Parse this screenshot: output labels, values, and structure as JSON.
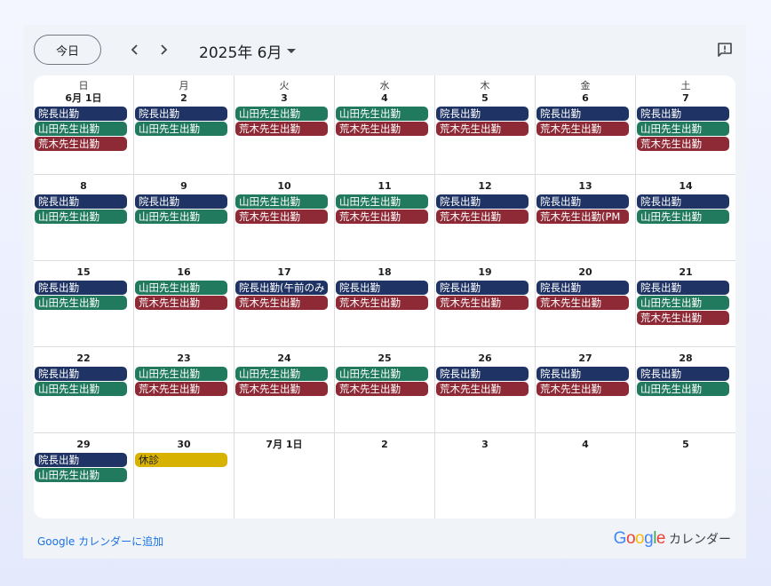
{
  "toolbar": {
    "today_label": "今日",
    "month_title": "2025年 6月"
  },
  "weekdays": [
    "日",
    "月",
    "火",
    "水",
    "木",
    "金",
    "土"
  ],
  "colors": {
    "navy": "#1f3464",
    "green": "#217a5d",
    "red": "#8e2a36",
    "yellow": "#d7b200"
  },
  "days": [
    {
      "label": "6月 1日",
      "events": [
        {
          "t": "院長出勤",
          "c": "navy"
        },
        {
          "t": "山田先生出勤",
          "c": "green"
        },
        {
          "t": "荒木先生出勤",
          "c": "red"
        }
      ]
    },
    {
      "label": "2",
      "events": [
        {
          "t": "院長出勤",
          "c": "navy"
        },
        {
          "t": "山田先生出勤",
          "c": "green"
        }
      ]
    },
    {
      "label": "3",
      "events": [
        {
          "t": "山田先生出勤",
          "c": "green"
        },
        {
          "t": "荒木先生出勤",
          "c": "red"
        }
      ]
    },
    {
      "label": "4",
      "events": [
        {
          "t": "山田先生出勤",
          "c": "green"
        },
        {
          "t": "荒木先生出勤",
          "c": "red"
        }
      ]
    },
    {
      "label": "5",
      "events": [
        {
          "t": "院長出勤",
          "c": "navy"
        },
        {
          "t": "荒木先生出勤",
          "c": "red"
        }
      ]
    },
    {
      "label": "6",
      "events": [
        {
          "t": "院長出勤",
          "c": "navy"
        },
        {
          "t": "荒木先生出勤",
          "c": "red"
        }
      ]
    },
    {
      "label": "7",
      "events": [
        {
          "t": "院長出勤",
          "c": "navy"
        },
        {
          "t": "山田先生出勤",
          "c": "green"
        },
        {
          "t": "荒木先生出勤",
          "c": "red"
        }
      ]
    },
    {
      "label": "8",
      "events": [
        {
          "t": "院長出勤",
          "c": "navy"
        },
        {
          "t": "山田先生出勤",
          "c": "green"
        }
      ]
    },
    {
      "label": "9",
      "events": [
        {
          "t": "院長出勤",
          "c": "navy"
        },
        {
          "t": "山田先生出勤",
          "c": "green"
        }
      ]
    },
    {
      "label": "10",
      "events": [
        {
          "t": "山田先生出勤",
          "c": "green"
        },
        {
          "t": "荒木先生出勤",
          "c": "red"
        }
      ]
    },
    {
      "label": "11",
      "events": [
        {
          "t": "山田先生出勤",
          "c": "green"
        },
        {
          "t": "荒木先生出勤",
          "c": "red"
        }
      ]
    },
    {
      "label": "12",
      "events": [
        {
          "t": "院長出勤",
          "c": "navy"
        },
        {
          "t": "荒木先生出勤",
          "c": "red"
        }
      ]
    },
    {
      "label": "13",
      "events": [
        {
          "t": "院長出勤",
          "c": "navy"
        },
        {
          "t": "荒木先生出勤(PM",
          "c": "red"
        }
      ]
    },
    {
      "label": "14",
      "events": [
        {
          "t": "院長出勤",
          "c": "navy"
        },
        {
          "t": "山田先生出勤",
          "c": "green"
        }
      ]
    },
    {
      "label": "15",
      "events": [
        {
          "t": "院長出勤",
          "c": "navy"
        },
        {
          "t": "山田先生出勤",
          "c": "green"
        }
      ]
    },
    {
      "label": "16",
      "events": [
        {
          "t": "山田先生出勤",
          "c": "green"
        },
        {
          "t": "荒木先生出勤",
          "c": "red"
        }
      ]
    },
    {
      "label": "17",
      "events": [
        {
          "t": "院長出勤(午前のみ",
          "c": "navy"
        },
        {
          "t": "荒木先生出勤",
          "c": "red"
        }
      ]
    },
    {
      "label": "18",
      "events": [
        {
          "t": "院長出勤",
          "c": "navy"
        },
        {
          "t": "荒木先生出勤",
          "c": "red"
        }
      ]
    },
    {
      "label": "19",
      "events": [
        {
          "t": "院長出勤",
          "c": "navy"
        },
        {
          "t": "荒木先生出勤",
          "c": "red"
        }
      ]
    },
    {
      "label": "20",
      "events": [
        {
          "t": "院長出勤",
          "c": "navy"
        },
        {
          "t": "荒木先生出勤",
          "c": "red"
        }
      ]
    },
    {
      "label": "21",
      "events": [
        {
          "t": "院長出勤",
          "c": "navy"
        },
        {
          "t": "山田先生出勤",
          "c": "green"
        },
        {
          "t": "荒木先生出勤",
          "c": "red"
        }
      ]
    },
    {
      "label": "22",
      "events": [
        {
          "t": "院長出勤",
          "c": "navy"
        },
        {
          "t": "山田先生出勤",
          "c": "green"
        }
      ]
    },
    {
      "label": "23",
      "events": [
        {
          "t": "山田先生出勤",
          "c": "green"
        },
        {
          "t": "荒木先生出勤",
          "c": "red"
        }
      ]
    },
    {
      "label": "24",
      "events": [
        {
          "t": "山田先生出勤",
          "c": "green"
        },
        {
          "t": "荒木先生出勤",
          "c": "red"
        }
      ]
    },
    {
      "label": "25",
      "events": [
        {
          "t": "山田先生出勤",
          "c": "green"
        },
        {
          "t": "荒木先生出勤",
          "c": "red"
        }
      ]
    },
    {
      "label": "26",
      "events": [
        {
          "t": "院長出勤",
          "c": "navy"
        },
        {
          "t": "荒木先生出勤",
          "c": "red"
        }
      ]
    },
    {
      "label": "27",
      "events": [
        {
          "t": "院長出勤",
          "c": "navy"
        },
        {
          "t": "荒木先生出勤",
          "c": "red"
        }
      ]
    },
    {
      "label": "28",
      "events": [
        {
          "t": "院長出勤",
          "c": "navy"
        },
        {
          "t": "山田先生出勤",
          "c": "green"
        }
      ]
    },
    {
      "label": "29",
      "events": [
        {
          "t": "院長出勤",
          "c": "navy"
        },
        {
          "t": "山田先生出勤",
          "c": "green"
        }
      ]
    },
    {
      "label": "30",
      "events": [
        {
          "t": "休診",
          "c": "yellow"
        }
      ]
    },
    {
      "label": "7月 1日",
      "events": []
    },
    {
      "label": "2",
      "events": []
    },
    {
      "label": "3",
      "events": []
    },
    {
      "label": "4",
      "events": []
    },
    {
      "label": "5",
      "events": []
    }
  ],
  "footer": {
    "add_link": "Google カレンダーに追加",
    "brand_google": "Google",
    "brand_calendar": "カレンダー"
  },
  "icons": {
    "prev": "chevron-left-icon",
    "next": "chevron-right-icon",
    "dropdown": "caret-down-icon",
    "feedback": "feedback-icon"
  }
}
